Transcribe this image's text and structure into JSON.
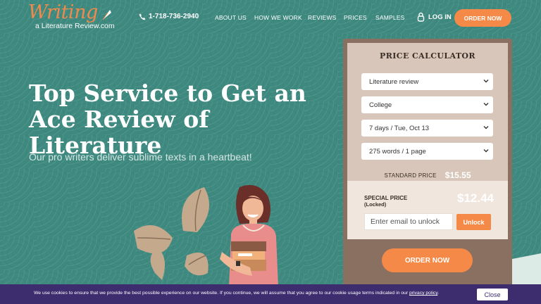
{
  "header": {
    "logo_script": "Writing",
    "logo_sub": "a Literature Review.com",
    "phone": "1-718-736-2940",
    "nav": [
      "ABOUT US",
      "HOW WE WORK",
      "REVIEWS",
      "PRICES",
      "SAMPLES"
    ],
    "login": "LOG IN",
    "order_button": "ORDER NOW"
  },
  "hero": {
    "title": "Top Service to Get an Ace Review of Literature",
    "subtitle": "Our pro writers deliver sublime texts in a heartbeat!"
  },
  "calculator": {
    "title": "PRICE CALCULATOR",
    "selects": [
      "Literature review",
      "College",
      "7 days / Tue, Oct 13",
      "275 words / 1 page"
    ],
    "standard_label": "STANDARD PRICE",
    "standard_value": "$15.55",
    "special_label": "SPECIAL PRICE",
    "special_locked": "(Locked)",
    "special_value": "$12.44",
    "email_placeholder": "Enter email to unlock",
    "unlock_button": "Unlock",
    "order_button": "ORDER NOW"
  },
  "cookie": {
    "text": "We use cookies to ensure that we provide the best possible experience on our website. If you continue, we will assume that you agree to our cookie usage terms indicated in our ",
    "link": "privacy policy",
    "suffix": ".",
    "close": "Close"
  },
  "colors": {
    "background": "#3f8a80",
    "accent": "#f58a48",
    "calculator_frame": "#8a7060",
    "cookie_bar": "#3d2c6e"
  }
}
